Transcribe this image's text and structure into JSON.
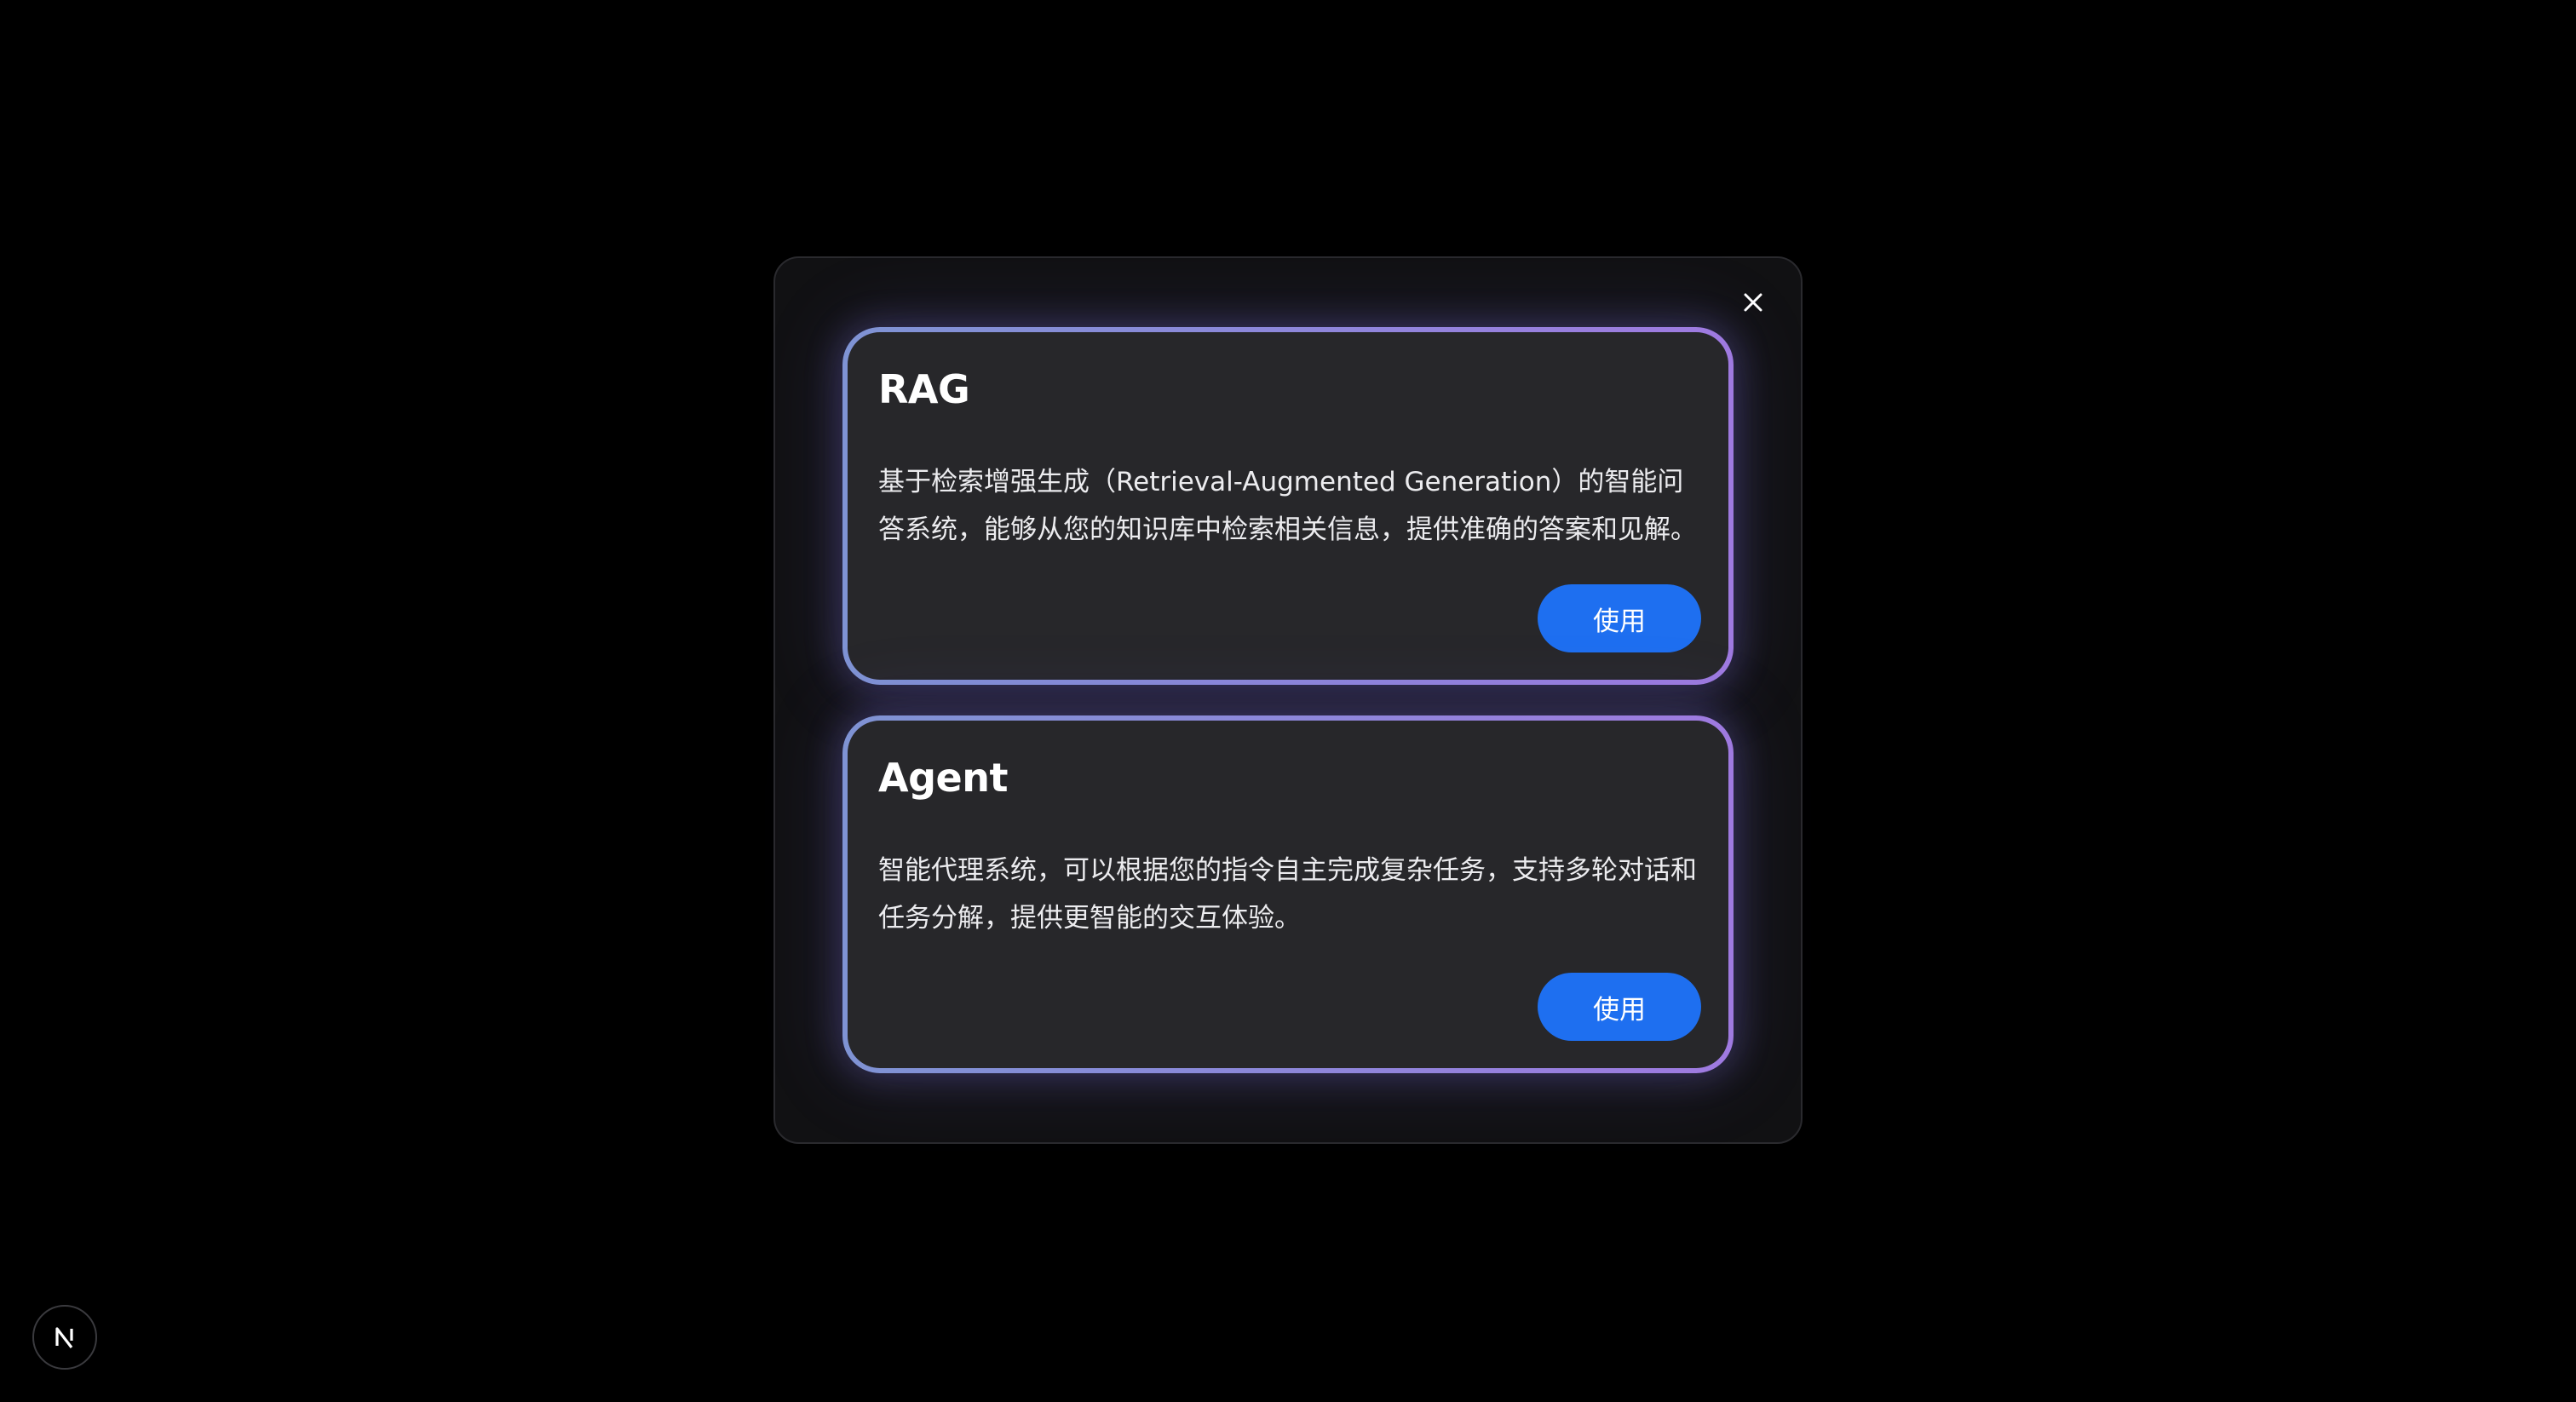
{
  "modal": {
    "close_icon": "close-icon",
    "cards": [
      {
        "title": "RAG",
        "description": "基于检索增强生成（Retrieval-Augmented Generation）的智能问答系统，能够从您的知识库中检索相关信息，提供准确的答案和见解。",
        "button_label": "使用"
      },
      {
        "title": "Agent",
        "description": "智能代理系统，可以根据您的指令自主完成复杂任务，支持多轮对话和任务分解，提供更智能的交互体验。",
        "button_label": "使用"
      }
    ]
  },
  "dev_badge": {
    "icon": "nextjs-logo-icon"
  },
  "colors": {
    "background": "#000000",
    "modal_background": "#111113",
    "card_background": "#27272a",
    "card_border_gradient_start": "#7f93d4",
    "card_border_gradient_end": "#9f7ae0",
    "button_blue": "#1e6ff0",
    "text_primary": "#ffffff"
  }
}
